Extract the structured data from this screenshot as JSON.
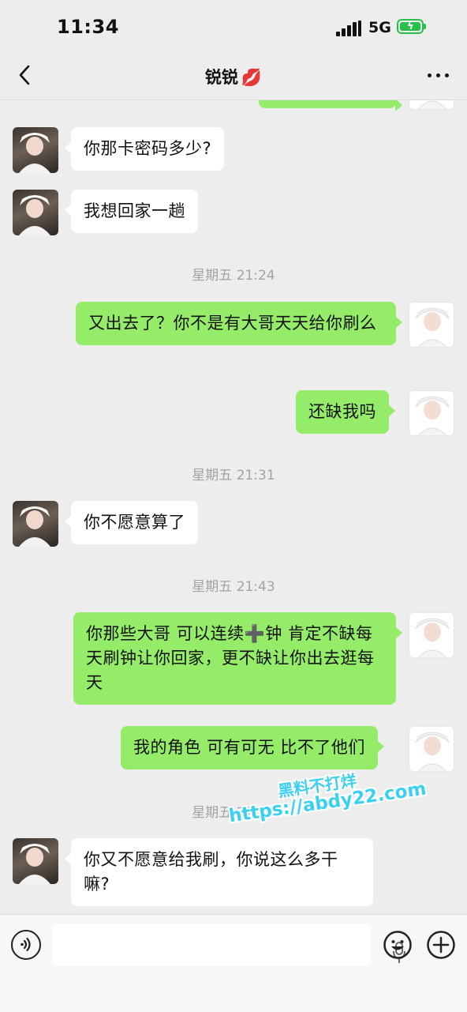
{
  "status_bar": {
    "time": "11:34",
    "network": "5G"
  },
  "header": {
    "title": "锐锐",
    "title_emoji": "💋"
  },
  "timestamps": [
    "星期五 21:24",
    "星期五 21:31",
    "星期五 21:43",
    "星期五 22:13"
  ],
  "messages": [
    {
      "from": "contact",
      "text": "你那卡密码多少?"
    },
    {
      "from": "contact",
      "text": "我想回家一趟"
    },
    {
      "from": "me",
      "text": "又出去了？你不是有大哥天天给你刷么"
    },
    {
      "from": "me",
      "text": "还缺我吗"
    },
    {
      "from": "contact",
      "text": "你不愿意算了"
    },
    {
      "from": "me",
      "text": "你那些大哥 可以连续➕钟 肯定不缺每天刷钟让你回家，更不缺让你出去逛每天"
    },
    {
      "from": "me",
      "text": "我的角色 可有可无 比不了他们"
    },
    {
      "from": "contact",
      "text": "你又不愿意给我刷，你说这么多干嘛?"
    }
  ],
  "watermark": {
    "line1": "黑料不打烊",
    "line2": "https://abdy22.com"
  },
  "input_bar": {
    "placeholder": ""
  },
  "colors": {
    "outgoing_bubble": "#95ec69",
    "incoming_bubble": "#ffffff",
    "background": "#ededed",
    "battery": "#27c04a"
  },
  "icons": [
    "back-icon",
    "more-icon",
    "voice-icon",
    "mic-icon",
    "emoji-icon",
    "plus-icon"
  ]
}
